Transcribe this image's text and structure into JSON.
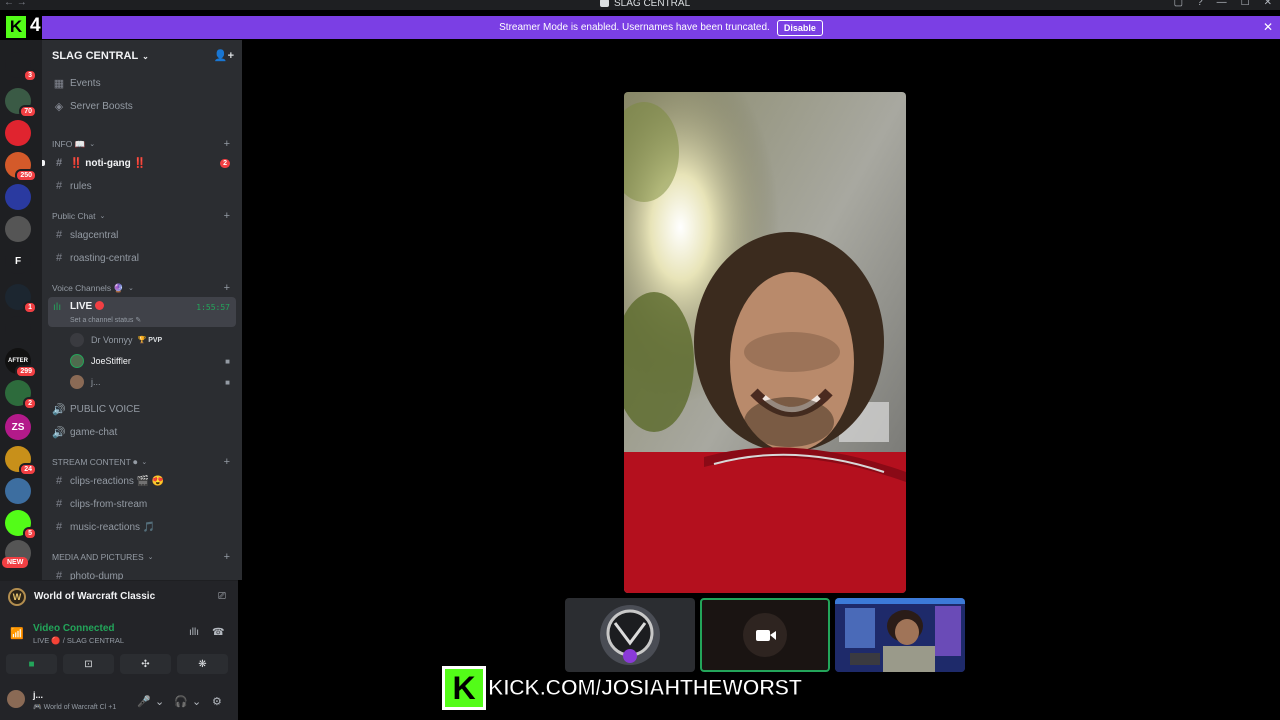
{
  "window": {
    "title": "SLAG CENTRAL",
    "nav_arrows": "← →",
    "controls": [
      "▢",
      "?",
      "—",
      "☐",
      "✕"
    ]
  },
  "banner": {
    "message": "Streamer Mode is enabled. Usernames have been truncated.",
    "button": "Disable",
    "close": "✕"
  },
  "overlay_top": {
    "k": "K",
    "number": "4"
  },
  "servers": [
    {
      "label": "",
      "badge": "3",
      "color": "#1e1f22"
    },
    {
      "label": "",
      "badge": "70",
      "color": "#3a5a45"
    },
    {
      "label": "",
      "badge": "",
      "color": "#e0242f"
    },
    {
      "label": "",
      "badge": "250",
      "color": "#d45a2a"
    },
    {
      "label": "",
      "badge": "",
      "color": "#2a3aa0"
    },
    {
      "label": "",
      "badge": "",
      "color": "#555"
    },
    {
      "label": "F",
      "badge": "",
      "color": "#1e1f22"
    },
    {
      "label": "",
      "badge": "1",
      "color": "#1c2630"
    },
    {
      "label": "",
      "badge": "",
      "color": "#1e1f22"
    },
    {
      "label": "AFTER",
      "badge": "299",
      "color": "#111"
    },
    {
      "label": "",
      "badge": "2",
      "color": "#2d6b3c"
    },
    {
      "label": "ZS",
      "badge": "",
      "color": "#b31a8a"
    },
    {
      "label": "",
      "badge": "24",
      "color": "#c8901a"
    },
    {
      "label": "",
      "badge": "",
      "color": "#3d6ea0"
    },
    {
      "label": "",
      "badge": "5",
      "color": "#53fc18"
    },
    {
      "label": "",
      "badge": "",
      "color": "#555"
    }
  ],
  "new_label": "NEW",
  "server": {
    "name": "SLAG CENTRAL",
    "top_items": [
      {
        "icon": "▦",
        "label": "Events"
      },
      {
        "icon": "◈",
        "label": "Server Boosts"
      }
    ],
    "categories": [
      {
        "name": "INFO 📖",
        "channels": [
          {
            "icon": "#",
            "label": "‼️ noti-gang ‼️",
            "bold": true,
            "badge": "2"
          },
          {
            "icon": "#",
            "label": "rules"
          }
        ]
      },
      {
        "name": "Public Chat",
        "channels": [
          {
            "icon": "#",
            "label": "slagcentral"
          },
          {
            "icon": "#",
            "label": "roasting-central"
          }
        ]
      },
      {
        "name": "Voice Channels 🔮",
        "channels": []
      },
      {
        "name": "STREAM CONTENT ⏺",
        "channels": [
          {
            "icon": "#",
            "label": "clips-reactions 🎬 😍"
          },
          {
            "icon": "#",
            "label": "clips-from-stream"
          },
          {
            "icon": "#",
            "label": "music-reactions 🎵"
          }
        ]
      },
      {
        "name": "MEDIA AND PICTURES",
        "channels": [
          {
            "icon": "#",
            "label": "photo-dump"
          }
        ]
      }
    ],
    "live_channel": {
      "name": "LIVE",
      "status": "Set a channel status ✎",
      "timer": "1:55:57",
      "users": [
        {
          "name": "Dr Vonnyy",
          "tag": "🏆 PVP",
          "cam": ""
        },
        {
          "name": "JoeStiffler",
          "tag": "",
          "cam": "■",
          "bright": true
        },
        {
          "name": "j...",
          "tag": "",
          "cam": "■"
        }
      ]
    },
    "voice_extra": [
      {
        "icon": "🔊",
        "label": "PUBLIC VOICE"
      },
      {
        "icon": "🔊",
        "label": "game-chat"
      }
    ]
  },
  "activity": {
    "game": "World of Warcraft Classic",
    "icon": "W"
  },
  "voice": {
    "status": "Video Connected",
    "channel": "LIVE 🔴 / SLAG CENTRAL",
    "buttons": [
      "■",
      "⊡",
      "✣",
      "❋"
    ]
  },
  "user": {
    "name": "j...",
    "status": "🎮 World of Warcraft Cl +1",
    "controls": [
      "🎤",
      "⌄",
      "🎧",
      "⌄",
      "⚙"
    ]
  },
  "overlay": {
    "logo": "K",
    "url": "KICK.COM/JOSIAHTHEWORST"
  },
  "colors": {
    "accent": "#5865f2",
    "banner": "#7b3fe4",
    "kick": "#53fc18",
    "online": "#23a55a",
    "alert": "#f23f43"
  }
}
